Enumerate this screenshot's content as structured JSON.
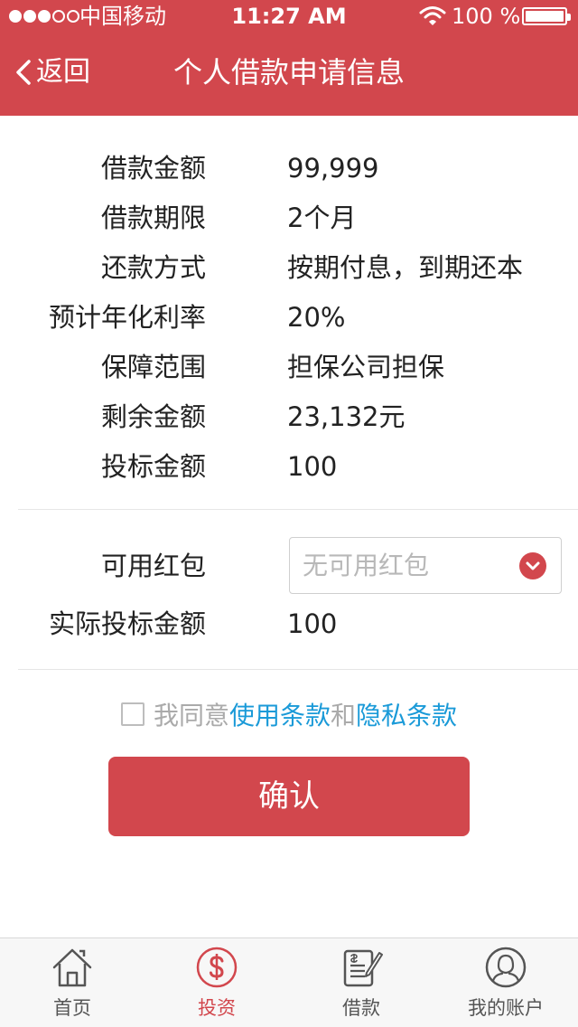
{
  "status_bar": {
    "carrier": "中国移动",
    "time": "11:27 AM",
    "battery": "100 %"
  },
  "nav": {
    "back_label": "返回",
    "title": "个人借款申请信息"
  },
  "info": [
    {
      "label": "借款金额",
      "value": "99,999"
    },
    {
      "label": "借款期限",
      "value": "2个月"
    },
    {
      "label": "还款方式",
      "value": "按期付息，到期还本"
    },
    {
      "label": "预计年化利率",
      "value": "20%"
    },
    {
      "label": "保障范围",
      "value": "担保公司担保"
    },
    {
      "label": "剩余金额",
      "value": "23,132元"
    },
    {
      "label": "投标金额",
      "value": "100"
    }
  ],
  "red_packet": {
    "label": "可用红包",
    "selected": "无可用红包"
  },
  "actual_amount": {
    "label": "实际投标金额",
    "value": "100"
  },
  "agreement": {
    "prefix": "我同意",
    "terms_link": "使用条款",
    "and": "和",
    "privacy_link": "隐私条款"
  },
  "confirm_label": "确认",
  "tabs": [
    {
      "label": "首页",
      "icon": "home-icon"
    },
    {
      "label": "投资",
      "icon": "dollar-icon"
    },
    {
      "label": "借款",
      "icon": "loan-document-icon"
    },
    {
      "label": "我的账户",
      "icon": "user-icon"
    }
  ],
  "colors": {
    "brand_red": "#d2474d",
    "link_blue": "#1a9ad8"
  }
}
